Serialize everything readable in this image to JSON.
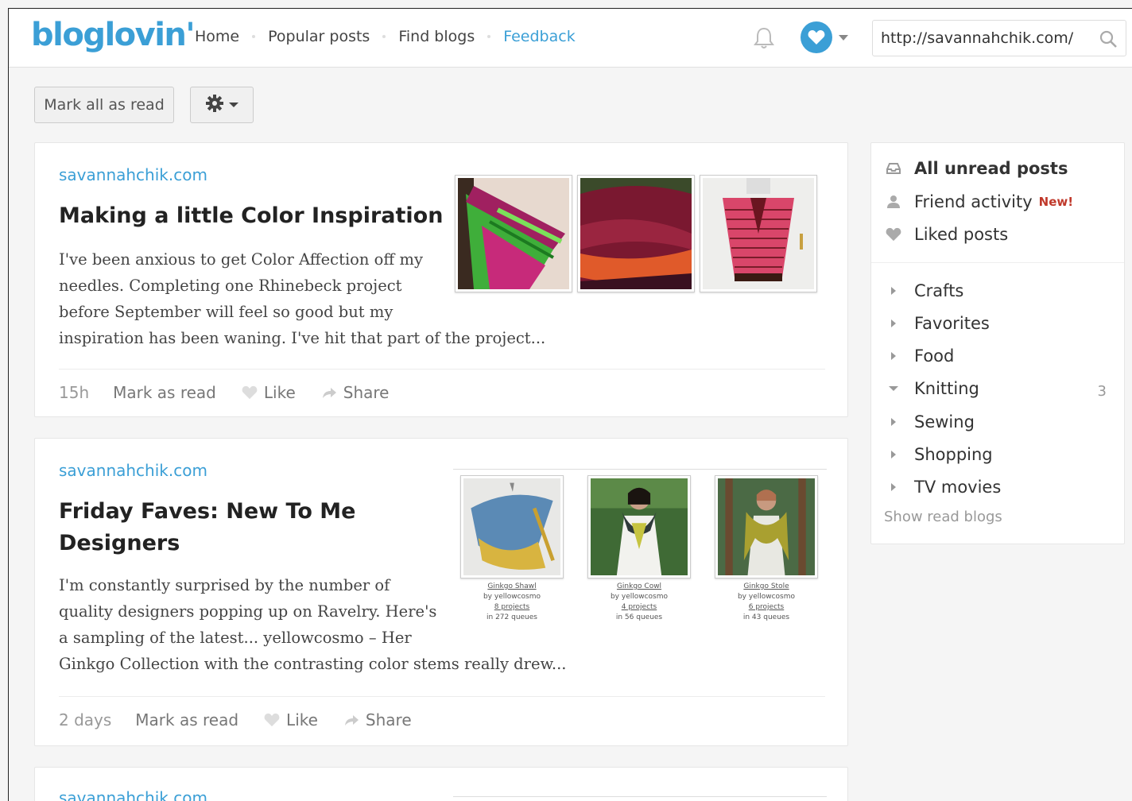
{
  "header": {
    "logo": "bloglovin'",
    "nav": [
      "Home",
      "Popular posts",
      "Find blogs",
      "Feedback"
    ],
    "search_value": "http://savannahchik.com/"
  },
  "toolbar": {
    "mark_all_label": "Mark all as read"
  },
  "posts": [
    {
      "blog": "savannahchik.com",
      "title": "Making a little Color Inspiration",
      "excerpt_lines": [
        "I've been anxious to get Color Affection off my",
        "needles. Completing one Rhinebeck project",
        "before September will feel so good but my",
        "inspiration has been waning. I've hit that part of the project..."
      ],
      "age": "15h",
      "mark_read": "Mark as read",
      "like": "Like",
      "share": "Share"
    },
    {
      "blog": "savannahchik.com",
      "title_lines": [
        "Friday Faves: New To Me",
        "Designers"
      ],
      "excerpt_lines": [
        "I'm constantly surprised by the number of",
        "quality designers popping up on Ravelry. Here's",
        "a sampling of the latest... yellowcosmo – Her",
        "Ginkgo Collection with the contrasting color stems really drew..."
      ],
      "patterns": [
        {
          "name": "Ginkgo Shawl",
          "by": "by yellowcosmo",
          "projects": "8 projects",
          "queues": "in 272 queues"
        },
        {
          "name": "Ginkgo Cowl",
          "by": "by yellowcosmo",
          "projects": "4 projects",
          "queues": "in 56 queues"
        },
        {
          "name": "Ginkgo Stole",
          "by": "by yellowcosmo",
          "projects": "6 projects",
          "queues": "in 43 queues"
        }
      ],
      "age": "2 days",
      "mark_read": "Mark as read",
      "like": "Like",
      "share": "Share"
    },
    {
      "blog": "savannahchik.com"
    }
  ],
  "sidebar": {
    "top": [
      {
        "label": "All unread posts"
      },
      {
        "label": "Friend activity",
        "badge": "New!"
      },
      {
        "label": "Liked posts"
      }
    ],
    "categories": [
      {
        "label": "Crafts"
      },
      {
        "label": "Favorites"
      },
      {
        "label": "Food"
      },
      {
        "label": "Knitting",
        "count": "3"
      },
      {
        "label": "Sewing"
      },
      {
        "label": "Shopping"
      },
      {
        "label": "TV movies"
      }
    ],
    "show_read": "Show read blogs"
  },
  "colors": {
    "brand": "#3b9fd6",
    "new_badge": "#c0392b"
  }
}
